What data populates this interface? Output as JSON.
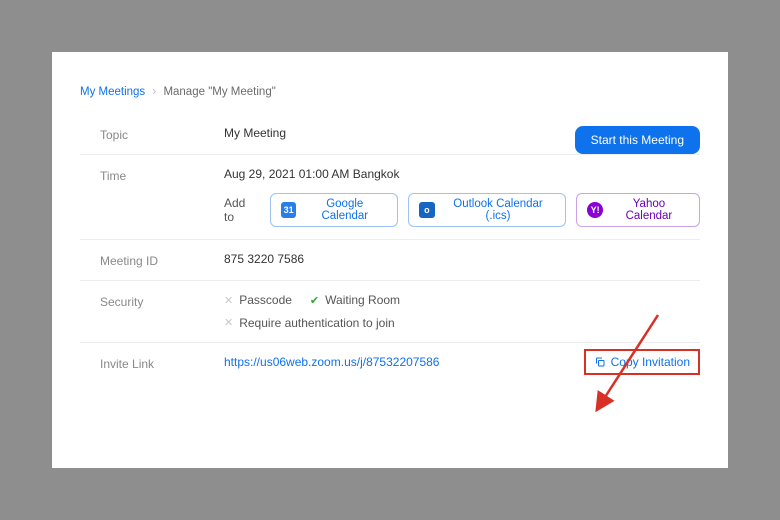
{
  "breadcrumb": {
    "root": "My Meetings",
    "sep": "›",
    "current": "Manage \"My Meeting\""
  },
  "start_button": "Start this Meeting",
  "labels": {
    "topic": "Topic",
    "time": "Time",
    "add_to": "Add to",
    "meeting_id": "Meeting ID",
    "security": "Security",
    "invite_link": "Invite Link"
  },
  "topic": "My Meeting",
  "time": "Aug 29, 2021 01:00 AM Bangkok",
  "calendars": {
    "google": "Google Calendar",
    "outlook": "Outlook Calendar (.ics)",
    "yahoo": "Yahoo Calendar",
    "g_badge": "31",
    "o_badge": "o",
    "y_badge": "Y!"
  },
  "meeting_id": "875 3220 7586",
  "security": {
    "passcode": "Passcode",
    "waiting_room": "Waiting Room",
    "require_auth": "Require authentication to join"
  },
  "invite_link": "https://us06web.zoom.us/j/87532207586",
  "copy_invitation": "Copy Invitation"
}
